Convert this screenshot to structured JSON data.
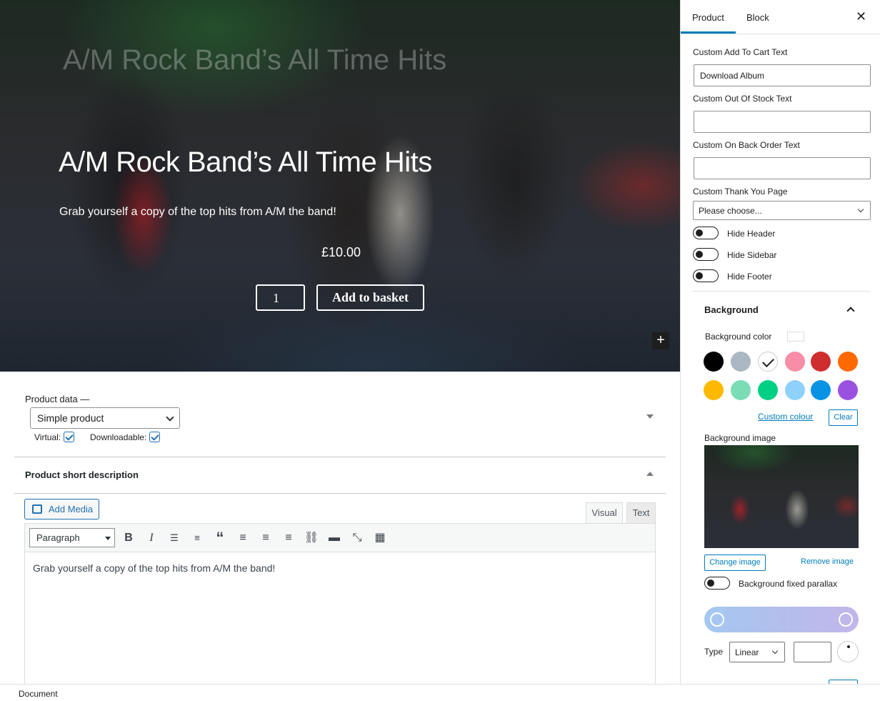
{
  "hero": {
    "ghost_title": "A/M Rock Band’s All Time Hits",
    "title": "A/M Rock Band’s All Time Hits",
    "subtitle": "Grab yourself a copy of the top hits from A/M the band!",
    "price": "£10.00",
    "quantity": "1",
    "add_button": "Add to basket",
    "add_block_icon": "+"
  },
  "product_data": {
    "label": "Product data —",
    "type_selected": "Simple product",
    "virtual_label": "Virtual:",
    "virtual_checked": true,
    "downloadable_label": "Downloadable:",
    "downloadable_checked": true
  },
  "short_description": {
    "title": "Product short description",
    "add_media": "Add Media",
    "tab_visual": "Visual",
    "tab_text": "Text",
    "format_selected": "Paragraph",
    "toolbar_icons": [
      "bold-icon",
      "italic-icon",
      "bullet-list-icon",
      "numbered-list-icon",
      "blockquote-icon",
      "align-left-icon",
      "align-center-icon",
      "align-right-icon",
      "link-icon",
      "more-icon",
      "fullscreen-icon",
      "toolbar-toggle-icon"
    ],
    "content": "Grab yourself a copy of the top hits from A/M the band!"
  },
  "footer": {
    "breadcrumb": "Document"
  },
  "sidebar": {
    "tabs": [
      "Product",
      "Block"
    ],
    "active_tab": "Product",
    "close_icon": "✕",
    "custom_add_to_cart_label": "Custom Add To Cart Text",
    "custom_add_to_cart_value": "Download Album",
    "custom_out_of_stock_label": "Custom Out Of Stock Text",
    "custom_out_of_stock_value": "",
    "custom_back_order_label": "Custom On Back Order Text",
    "custom_back_order_value": "",
    "thank_you_label": "Custom Thank You Page",
    "thank_you_selected": "Please choose...",
    "hide_header": "Hide Header",
    "hide_sidebar": "Hide Sidebar",
    "hide_footer": "Hide Footer",
    "background": {
      "title": "Background",
      "color_label": "Background color",
      "swatches": [
        "#000000",
        "#abb8c3",
        "#ffffff",
        "#f78da7",
        "#cf2e2e",
        "#ff6900",
        "#fcb900",
        "#7bdcb5",
        "#00d084",
        "#8ed1fc",
        "#0693e3",
        "#9b51e0"
      ],
      "selected_swatch": "#ffffff",
      "custom_colour": "Custom colour",
      "clear": "Clear",
      "image_label": "Background image",
      "change_image": "Change image",
      "remove_image": "Remove image",
      "parallax_label": "Background fixed parallax",
      "gradient_colors": [
        "#a4c8f0",
        "#c3b5ea"
      ],
      "type_label": "Type",
      "type_selected": "Linear"
    }
  }
}
